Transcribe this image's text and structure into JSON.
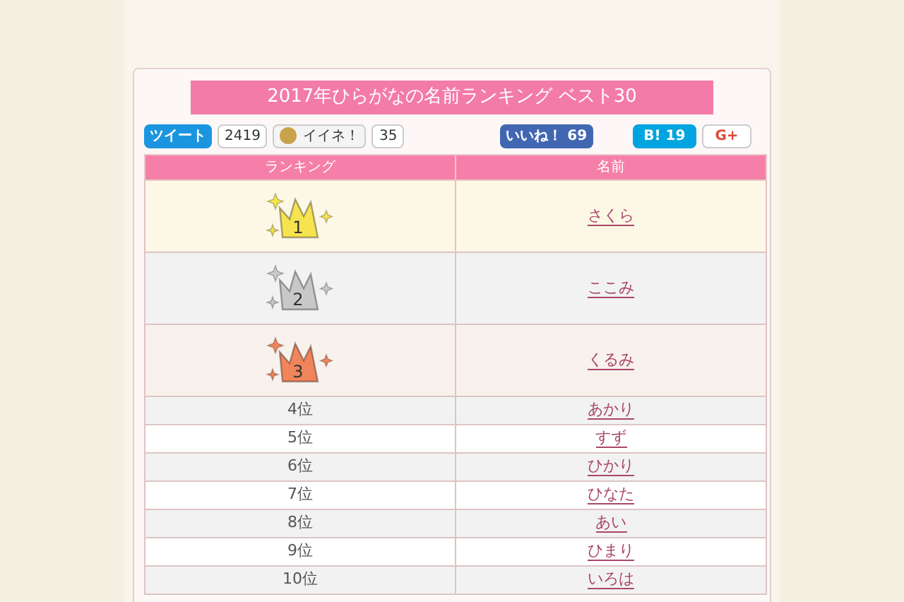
{
  "title": "2017年ひらがなの名前ランキング ベスト30",
  "social": [
    {
      "kind": "tweet",
      "label": "ツイート",
      "count": "2419"
    },
    {
      "kind": "mixi",
      "label": "イイネ！",
      "count": "35"
    },
    {
      "kind": "facebook",
      "label": "いいね！",
      "count": "69"
    },
    {
      "kind": "hatena",
      "label": "B!",
      "count": "19"
    },
    {
      "kind": "gplus",
      "label": "G+"
    }
  ],
  "table": {
    "columns": [
      "ランキング",
      "名前"
    ],
    "rows": [
      {
        "kind": "crown",
        "rank": "1",
        "color": "#f5e34f",
        "name": "さくら"
      },
      {
        "kind": "crown",
        "rank": "2",
        "color": "#c8c8c8",
        "name": "ここみ"
      },
      {
        "kind": "crown",
        "rank": "3",
        "color": "#f0845a",
        "name": "くるみ"
      },
      {
        "kind": "text",
        "rank": "4位",
        "name": "あかり"
      },
      {
        "kind": "text",
        "rank": "5位",
        "name": "すず"
      },
      {
        "kind": "text",
        "rank": "6位",
        "name": "ひかり"
      },
      {
        "kind": "text",
        "rank": "7位",
        "name": "ひなた"
      },
      {
        "kind": "text",
        "rank": "8位",
        "name": "あい"
      },
      {
        "kind": "text",
        "rank": "9位",
        "name": "ひまり"
      },
      {
        "kind": "text",
        "rank": "10位",
        "name": "いろは"
      }
    ]
  }
}
